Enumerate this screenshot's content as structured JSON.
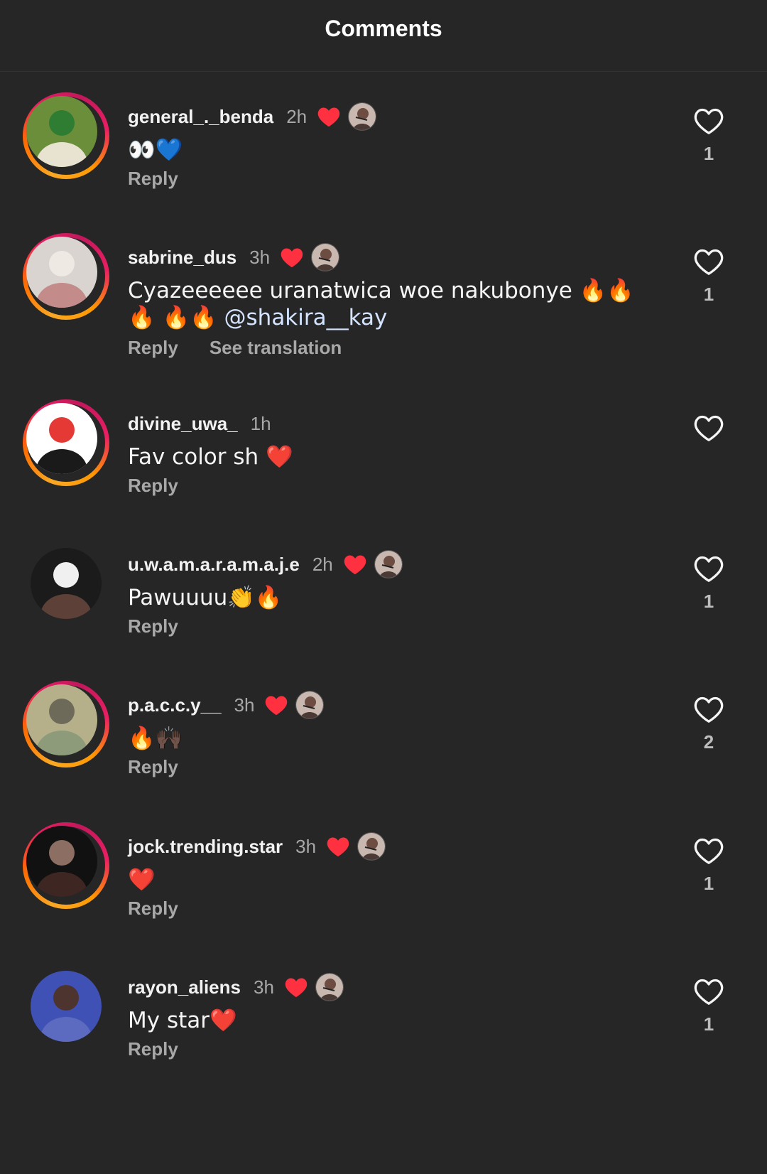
{
  "header": {
    "title": "Comments"
  },
  "comments": [
    {
      "username": "general_._benda",
      "time": "2h",
      "creator_liked": true,
      "text": "👀💙",
      "mention": "",
      "reply_label": "Reply",
      "translate_label": "",
      "likes": "1",
      "story_ring": true,
      "avatar_colors": [
        "#6b8e3a",
        "#e8e2d0",
        "#2e7d32"
      ]
    },
    {
      "username": "sabrine_dus",
      "time": "3h",
      "creator_liked": true,
      "text": "Cyazeeeeee uranatwica woe nakubonye 🔥🔥🔥 🔥🔥 ",
      "mention": "@shakira__kay",
      "reply_label": "Reply",
      "translate_label": "See translation",
      "likes": "1",
      "story_ring": true,
      "avatar_colors": [
        "#d9d4cf",
        "#c48b8b",
        "#efe9e4"
      ]
    },
    {
      "username": "divine_uwa_",
      "time": "1h",
      "creator_liked": false,
      "text": "Fav color sh ❤️",
      "mention": "",
      "reply_label": "Reply",
      "translate_label": "",
      "likes": "",
      "story_ring": true,
      "avatar_colors": [
        "#ffffff",
        "#1a1a1a",
        "#e53935"
      ]
    },
    {
      "username": "u.w.a.m.a.r.a.m.a.j.e",
      "time": "2h",
      "creator_liked": true,
      "text": "Pawuuuu👏🔥",
      "mention": "",
      "reply_label": "Reply",
      "translate_label": "",
      "likes": "1",
      "story_ring": false,
      "avatar_colors": [
        "#1b1b1b",
        "#5d4037",
        "#f0f0f0"
      ]
    },
    {
      "username": "p.a.c.c.y__",
      "time": "3h",
      "creator_liked": true,
      "text": "🔥🙌🏿",
      "mention": "",
      "reply_label": "Reply",
      "translate_label": "",
      "likes": "2",
      "story_ring": true,
      "avatar_colors": [
        "#b5b08a",
        "#8d9b7a",
        "#6e6a5a"
      ]
    },
    {
      "username": "jock.trending.star",
      "time": "3h",
      "creator_liked": true,
      "text": "❤️",
      "mention": "",
      "reply_label": "Reply",
      "translate_label": "",
      "likes": "1",
      "story_ring": true,
      "avatar_colors": [
        "#111111",
        "#3e2723",
        "#8d6e63"
      ]
    },
    {
      "username": "rayon_aliens",
      "time": "3h",
      "creator_liked": true,
      "text": "My star❤️",
      "mention": "",
      "reply_label": "Reply",
      "translate_label": "",
      "likes": "1",
      "story_ring": false,
      "avatar_colors": [
        "#3f51b5",
        "#5c6bc0",
        "#4e342e"
      ]
    }
  ],
  "icons": {
    "like": "heart-outline-icon",
    "creator_like": "heart-filled-icon",
    "creator_avatar": "creator-avatar-icon"
  },
  "colors": {
    "liked_red": "#ff3040",
    "background": "#262626",
    "secondary_text": "#a8a8a8"
  }
}
